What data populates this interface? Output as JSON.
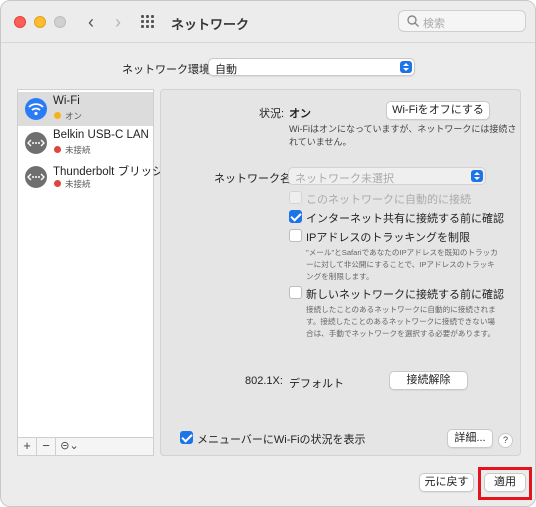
{
  "window": {
    "title": "ネットワーク",
    "search_placeholder": "検索"
  },
  "location": {
    "label": "ネットワーク環境:",
    "value": "自動"
  },
  "sidebar": {
    "services": [
      {
        "name": "Wi-Fi",
        "status": "オン",
        "status_color": "#f5b31b",
        "icon": "wifi-icon",
        "selected": true
      },
      {
        "name": "Belkin USB-C LAN",
        "status": "未接続",
        "status_color": "#e0443e",
        "icon": "ethernet-icon",
        "selected": false
      },
      {
        "name": "Thunderbolt ブリッジ",
        "status": "未接続",
        "status_color": "#e0443e",
        "icon": "thunderbolt-bridge-icon",
        "selected": false
      }
    ],
    "tools": {
      "add": "+",
      "remove": "−",
      "action": "⊝⌄"
    }
  },
  "detail": {
    "status_label": "状況:",
    "status_value": "オン",
    "wifi_off_button": "Wi-Fiをオフにする",
    "status_desc": "Wi-Fiはオンになっていますが、ネットワークには接続されていません。",
    "network_name_label": "ネットワーク名:",
    "network_name_placeholder": "ネットワーク未選択",
    "auto_join": {
      "label": "このネットワークに自動的に接続",
      "checked": false,
      "disabled": true
    },
    "ask_hotspot": {
      "label": "インターネット共有に接続する前に確認",
      "checked": true
    },
    "limit_tracking": {
      "label": "IPアドレスのトラッキングを制限",
      "checked": false
    },
    "limit_tracking_desc": "\"メール\"とSafariであなたのIPアドレスを既知のトラッカーに対して非公開にすることで、IPアドレスのトラッキングを制限します。",
    "ask_new": {
      "label": "新しいネットワークに接続する前に確認",
      "checked": false
    },
    "ask_new_desc": "接続したことのあるネットワークに自動的に接続されます。接続したことのあるネットワークに接続できない場合は、手動でネットワークを選択する必要があります。",
    "dot1x_label": "802.1X:",
    "dot1x_value": "デフォルト",
    "disconnect_button": "接続解除",
    "show_menu": {
      "label": "メニューバーにWi-Fiの状況を表示",
      "checked": true
    },
    "advanced_button": "詳細...",
    "help": "?"
  },
  "footer": {
    "revert_button": "元に戻す",
    "apply_button": "適用"
  },
  "colors": {
    "accent": "#1d73e8",
    "highlight_box": "#e3141b"
  }
}
